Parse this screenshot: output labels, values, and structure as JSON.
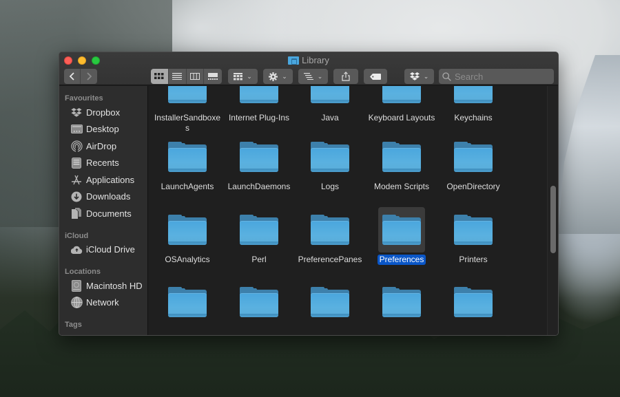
{
  "window": {
    "title": "Library",
    "title_icon": "library-folder-icon"
  },
  "toolbar": {
    "back_label": "‹",
    "forward_label": "›",
    "view_modes": [
      {
        "name": "icon-view",
        "active": true
      },
      {
        "name": "list-view",
        "active": false
      },
      {
        "name": "column-view",
        "active": false
      },
      {
        "name": "gallery-view",
        "active": false
      }
    ],
    "arrange_icon": "group-icon",
    "action_icon": "gear-icon",
    "sort_icon": "sort-icon",
    "share_icon": "share-icon",
    "tag_icon": "tag-icon",
    "dropbox_icon": "dropbox-icon",
    "chevron": "⌄",
    "search": {
      "placeholder": "Search",
      "value": ""
    }
  },
  "sidebar": {
    "sections": [
      {
        "title": "Favourites",
        "items": [
          {
            "label": "Dropbox",
            "icon": "dropbox-icon"
          },
          {
            "label": "Desktop",
            "icon": "desktop-icon"
          },
          {
            "label": "AirDrop",
            "icon": "airdrop-icon"
          },
          {
            "label": "Recents",
            "icon": "recents-icon"
          },
          {
            "label": "Applications",
            "icon": "applications-icon"
          },
          {
            "label": "Downloads",
            "icon": "downloads-icon"
          },
          {
            "label": "Documents",
            "icon": "documents-icon"
          }
        ]
      },
      {
        "title": "iCloud",
        "items": [
          {
            "label": "iCloud Drive",
            "icon": "icloud-icon"
          }
        ]
      },
      {
        "title": "Locations",
        "items": [
          {
            "label": "Macintosh HD",
            "icon": "hard-drive-icon"
          },
          {
            "label": "Network",
            "icon": "network-icon"
          }
        ]
      },
      {
        "title": "Tags",
        "items": []
      }
    ]
  },
  "content": {
    "rows": [
      [
        "InstallerSandboxes",
        "Internet Plug-Ins",
        "Java",
        "Keyboard Layouts",
        "Keychains"
      ],
      [
        "LaunchAgents",
        "LaunchDaemons",
        "Logs",
        "Modem Scripts",
        "OpenDirectory"
      ],
      [
        "OSAnalytics",
        "Perl",
        "PreferencePanes",
        "Preferences",
        "Printers"
      ],
      [
        "",
        "",
        "",
        "",
        ""
      ]
    ],
    "selected": "Preferences"
  },
  "colors": {
    "selection": "#0a56c7",
    "folder": "#4aa6dd",
    "window_bg": "#1f1f1f",
    "sidebar_bg": "#2d2d2d"
  },
  "scroll": {
    "position_fraction": 0.55,
    "visible_fraction": 0.27
  }
}
